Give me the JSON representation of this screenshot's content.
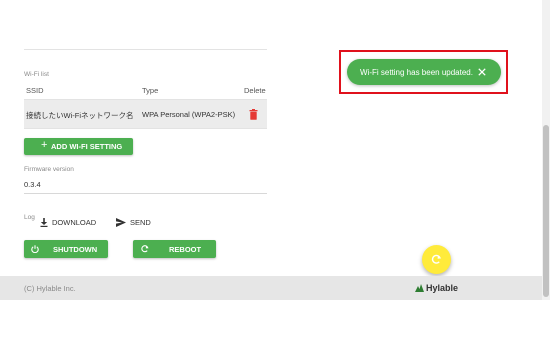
{
  "wifi_list": {
    "section_label": "Wi-Fi list",
    "columns": {
      "ssid": "SSID",
      "type": "Type",
      "delete": "Delete"
    },
    "rows": [
      {
        "ssid": "接続したいWi-Fiネットワーク名",
        "type": "WPA Personal (WPA2-PSK)"
      }
    ],
    "add_button_label": "ADD WI-FI SETTING"
  },
  "firmware": {
    "label": "Firmware version",
    "value": "0.3.4"
  },
  "log": {
    "label": "Log",
    "download_label": "DOWNLOAD",
    "send_label": "SEND"
  },
  "actions": {
    "shutdown_label": "SHUTDOWN",
    "reboot_label": "REBOOT"
  },
  "footer": {
    "copyright": "(C) Hylable Inc.",
    "logo_text": "Hylable"
  },
  "toast": {
    "message": "Wi-Fi setting has been updated."
  },
  "colors": {
    "primary_green": "#4caf50",
    "delete_red": "#e53935",
    "fab_yellow": "#ffeb3b",
    "highlight_red": "#e0111c"
  }
}
